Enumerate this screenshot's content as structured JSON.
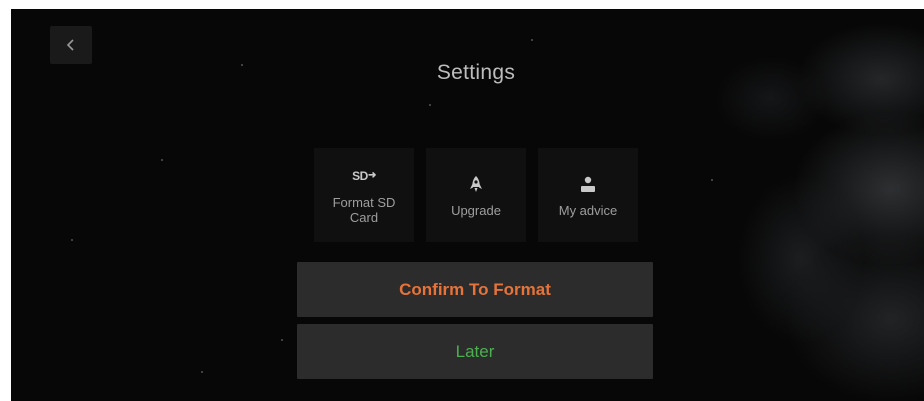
{
  "header": {
    "title": "Settings",
    "back_icon": "chevron-left-icon"
  },
  "tiles": [
    {
      "label": "Format SD Card",
      "icon": "sd-card-icon"
    },
    {
      "label": "Upgrade",
      "icon": "rocket-icon"
    },
    {
      "label": "My advice",
      "icon": "person-icon"
    }
  ],
  "actions": {
    "confirm_label": "Confirm To Format",
    "later_label": "Later"
  },
  "colors": {
    "confirm_text": "#e5733a",
    "later_text": "#4caf50",
    "background": "#070707",
    "button_bg": "#2c2c2c"
  }
}
